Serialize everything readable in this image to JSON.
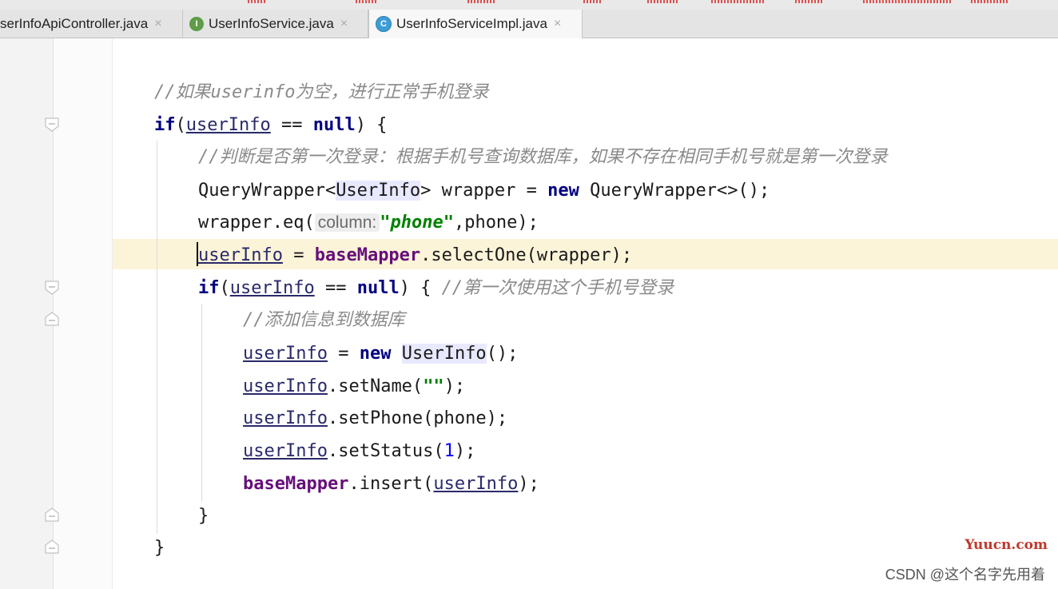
{
  "tabs": [
    {
      "label": "serInfoApiController.java",
      "icon": "",
      "active": false
    },
    {
      "label": "UserInfoService.java",
      "icon": "I",
      "active": false
    },
    {
      "label": "UserInfoServiceImpl.java",
      "icon": "C",
      "active": true
    }
  ],
  "close_glyph": "×",
  "code": {
    "l1_comment": "//如果userinfo为空，进行正常手机登录",
    "l2_if": "if",
    "l2_paren": "(",
    "l2_var": "userInfo",
    "l2_eq": " == ",
    "l2_null": "null",
    "l2_end": ") {",
    "l3_comment": "//判断是否第一次登录：根据手机号查询数据库，如果不存在相同手机号就是第一次登录",
    "l4_a": "QueryWrapper<",
    "l4_type": "UserInfo",
    "l4_b": "> wrapper = ",
    "l4_new": "new",
    "l4_c": " QueryWrapper<>();",
    "l5_a": "wrapper.eq(",
    "l5_hint": "column:",
    "l5_str": "\"phone\"",
    "l5_b": ",phone);",
    "l6_var": "userInfo",
    "l6_a": " = ",
    "l6_field": "baseMapper",
    "l6_b": ".selectOne(wrapper);",
    "l7_if": "if",
    "l7_paren": "(",
    "l7_var": "userInfo",
    "l7_eq": " == ",
    "l7_null": "null",
    "l7_end": ") { ",
    "l7_comment": "//第一次使用这个手机号登录",
    "l8_comment": "//添加信息到数据库",
    "l9_var": "userInfo",
    "l9_a": " = ",
    "l9_new": "new",
    "l9_sp": " ",
    "l9_type": "UserInfo",
    "l9_b": "();",
    "l10_var": "userInfo",
    "l10_a": ".setName(",
    "l10_str": "\"\"",
    "l10_b": ");",
    "l11_var": "userInfo",
    "l11_a": ".setPhone(phone);",
    "l12_var": "userInfo",
    "l12_a": ".setStatus(",
    "l12_num": "1",
    "l12_b": ");",
    "l13_field": "baseMapper",
    "l13_a": ".insert(",
    "l13_var": "userInfo",
    "l13_b": ");",
    "l14": "}",
    "l15": "}"
  },
  "watermark": {
    "site": "Yuucn.com",
    "credit": "CSDN @这个名字先用着"
  },
  "colors": {
    "keyword": "#000080",
    "comment": "#8a8a8a",
    "string": "#008000",
    "field": "#660e7a",
    "current_line": "#fcf4d8"
  }
}
